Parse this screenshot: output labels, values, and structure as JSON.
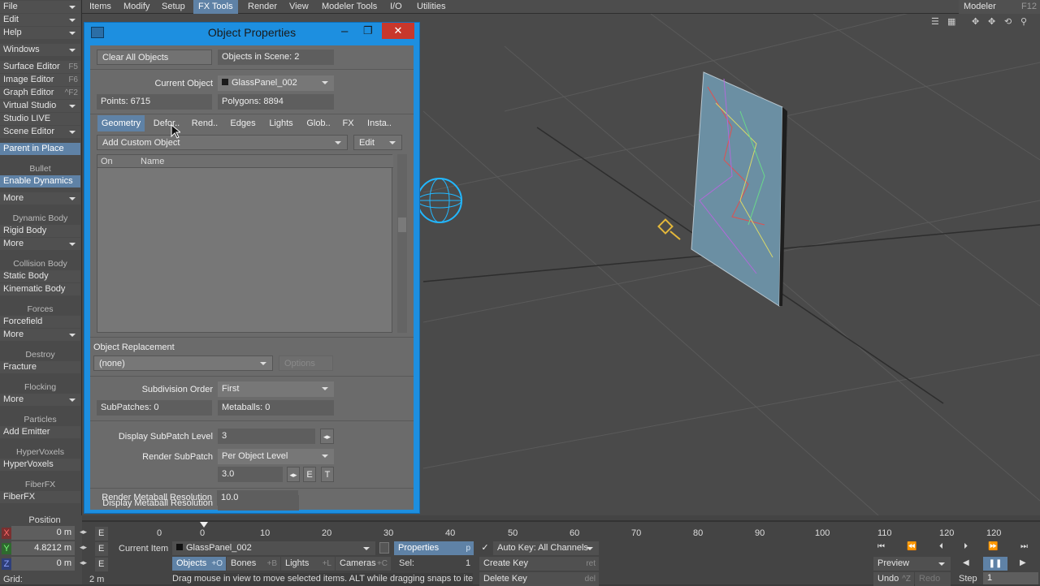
{
  "menubar": {
    "tabs": [
      "Items",
      "Modify",
      "Setup",
      "FX Tools",
      "Render",
      "View",
      "Modeler Tools",
      "I/O",
      "Utilities"
    ],
    "active_tab": "FX Tools",
    "modeler_label": "Modeler",
    "modeler_key": "F12"
  },
  "left_toolbar": {
    "file": "File",
    "edit": "Edit",
    "help": "Help",
    "windows": "Windows",
    "surface_editor": "Surface Editor",
    "surface_editor_key": "F5",
    "image_editor": "Image Editor",
    "image_editor_key": "F6",
    "graph_editor": "Graph Editor",
    "graph_editor_key": "^F2",
    "virtual_studio": "Virtual Studio",
    "studio_live": "Studio LIVE",
    "scene_editor": "Scene Editor",
    "parent_in_place": "Parent in Place",
    "bullet_header": "Bullet",
    "enable_dynamics": "Enable Dynamics",
    "more": "More",
    "dynamic_body_header": "Dynamic Body",
    "rigid_body": "Rigid Body",
    "collision_body_header": "Collision Body",
    "static_body": "Static Body",
    "kinematic_body": "Kinematic Body",
    "forces_header": "Forces",
    "forcefield": "Forcefield",
    "destroy_header": "Destroy",
    "fracture": "Fracture",
    "flocking_header": "Flocking",
    "particles_header": "Particles",
    "add_emitter": "Add Emitter",
    "hypervoxels_header": "HyperVoxels",
    "hypervoxels": "HyperVoxels",
    "fiberfx_header": "FiberFX",
    "fiberfx": "FiberFX"
  },
  "dialog": {
    "title": "Object Properties",
    "clear_all_objects": "Clear All Objects",
    "objects_in_scene": "Objects in Scene: 2",
    "current_object_label": "Current Object",
    "current_object": "GlassPanel_002",
    "points": "Points: 6715",
    "polygons": "Polygons: 8894",
    "tabs": [
      "Geometry",
      "Defor..",
      "Rend..",
      "Edges",
      "Lights",
      "Glob..",
      "FX",
      "Insta.."
    ],
    "active_tab": "Geometry",
    "add_custom_object": "Add Custom Object",
    "edit": "Edit",
    "col_on": "On",
    "col_name": "Name",
    "object_replacement": "Object Replacement",
    "replacement_value": "(none)",
    "options": "Options",
    "subdivision_order_label": "Subdivision Order",
    "subdivision_order": "First",
    "subpatches": "SubPatches: 0",
    "metaballs": "Metaballs: 0",
    "display_subpatch_label": "Display SubPatch Level",
    "display_subpatch": "3",
    "render_subpatch_label": "Render SubPatch",
    "render_subpatch": "Per Object Level",
    "render_subpatch_value": "3.0",
    "e_btn": "E",
    "t_btn": "T",
    "display_metaball_label": "Display Metaball Resolution",
    "display_metaball": "10.0",
    "render_metaball_label": "Render Metaball Resolution",
    "render_metaball": "10.0"
  },
  "timeline": {
    "position_label": "Position",
    "x_label": "X",
    "y_label": "Y",
    "z_label": "Z",
    "x_value": "0 m",
    "y_value": "4.8212 m",
    "z_value": "0 m",
    "grid_label": "Grid:",
    "grid_value": "2 m",
    "e": "E",
    "ticks": [
      "0",
      "0",
      "10",
      "20",
      "30",
      "40",
      "50",
      "60",
      "70",
      "80",
      "90",
      "100",
      "110",
      "120",
      "120"
    ],
    "current_item_label": "Current Item",
    "current_item": "GlassPanel_002",
    "properties": "Properties",
    "properties_key": "p",
    "auto_key": "Auto Key: All Channels",
    "objects": "Objects",
    "objects_key": "+O",
    "bones": "Bones",
    "bones_key": "+B",
    "lights": "Lights",
    "lights_key": "+L",
    "cameras": "Cameras",
    "cameras_key": "+C",
    "sel_label": "Sel:",
    "sel_value": "1",
    "create_key": "Create Key",
    "create_key_shortcut": "ret",
    "delete_key": "Delete Key",
    "delete_key_shortcut": "del",
    "status": "Drag mouse in view to move selected items. ALT while dragging snaps to ite",
    "preview": "Preview",
    "undo": "Undo",
    "undo_key": "^Z",
    "redo": "Redo",
    "step_label": "Step",
    "step_value": "1"
  }
}
